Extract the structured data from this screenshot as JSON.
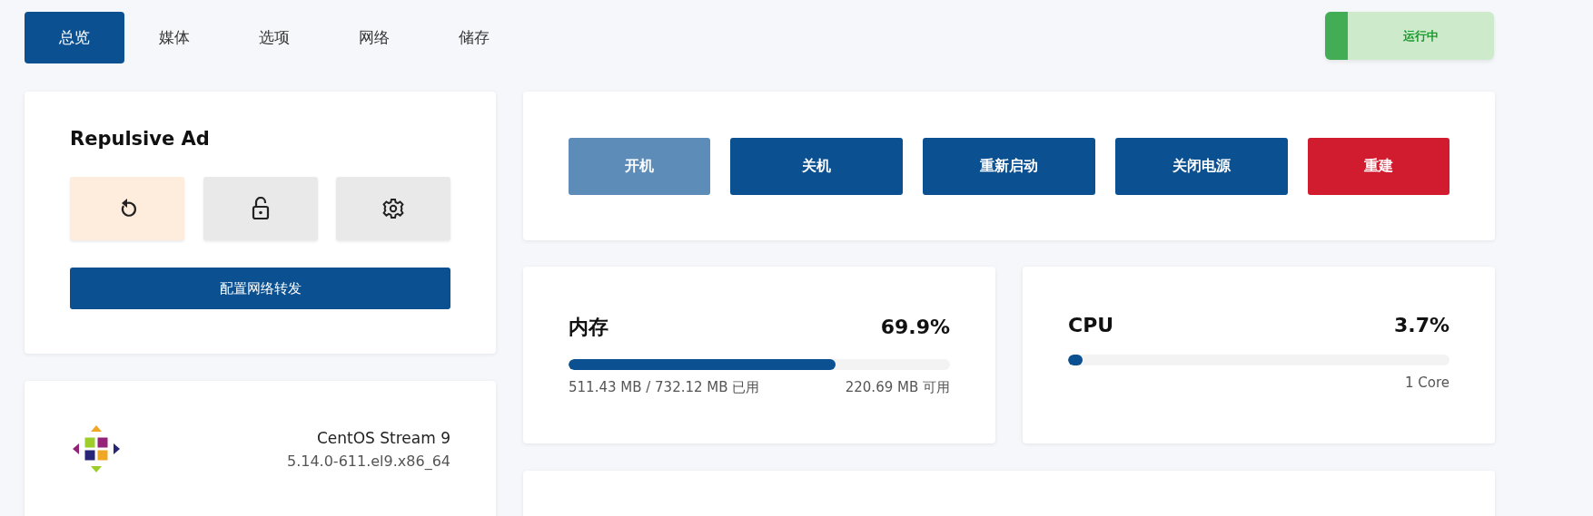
{
  "tabs": [
    {
      "label": "总览",
      "selected": true
    },
    {
      "label": "媒体",
      "selected": false
    },
    {
      "label": "选项",
      "selected": false
    },
    {
      "label": "网络",
      "selected": false
    },
    {
      "label": "储存",
      "selected": false
    }
  ],
  "status": {
    "label": "运行中",
    "kind": "running"
  },
  "server_card": {
    "title": "Repulsive Ad",
    "icon_buttons": [
      {
        "kind": "reset",
        "highlighted": true
      },
      {
        "kind": "lock",
        "highlighted": false
      },
      {
        "kind": "settings",
        "highlighted": false
      }
    ],
    "action": "配置网络转发"
  },
  "os_card": {
    "name": "CentOS Stream 9",
    "kernel": "5.14.0-611.el9.x86_64"
  },
  "power_buttons": [
    {
      "label": "开机",
      "kind": "disabled"
    },
    {
      "label": "关机",
      "kind": "primary"
    },
    {
      "label": "重新启动",
      "kind": "primary"
    },
    {
      "label": "关闭电源",
      "kind": "primary"
    },
    {
      "label": "重建",
      "kind": "danger"
    }
  ],
  "meters": [
    {
      "title": "内存",
      "reading": "69.9%",
      "level": 0.699,
      "left_note": "511.43 MB / 732.12 MB 已用",
      "right_note": "220.69 MB 可用"
    },
    {
      "title": "CPU",
      "reading": "3.7%",
      "level": 0.037,
      "right_note": "1 Core"
    }
  ]
}
